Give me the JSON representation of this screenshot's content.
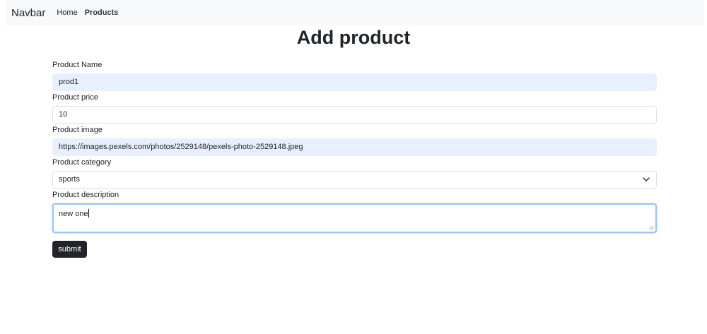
{
  "navbar": {
    "brand": "Navbar",
    "links": [
      {
        "label": "Home",
        "active": false
      },
      {
        "label": "Products",
        "active": true
      }
    ]
  },
  "page": {
    "title": "Add product"
  },
  "form": {
    "name": {
      "label": "Product Name",
      "value": "prod1"
    },
    "price": {
      "label": "Product price",
      "value": "10"
    },
    "image": {
      "label": "Product image",
      "value": "https://images.pexels.com/photos/2529148/pexels-photo-2529148.jpeg"
    },
    "category": {
      "label": "Product category",
      "value": "sports"
    },
    "description": {
      "label": "Product description",
      "value": "new one"
    },
    "submit_label": "submit"
  },
  "icons": {
    "select": "chevron-down-icon",
    "textarea": "resize-grip-icon"
  },
  "colors": {
    "navbar_bg": "#f8f9fa",
    "autofill_bg": "#e8f0fe",
    "focus_border": "#9ec5fe",
    "button_bg": "#212529"
  }
}
